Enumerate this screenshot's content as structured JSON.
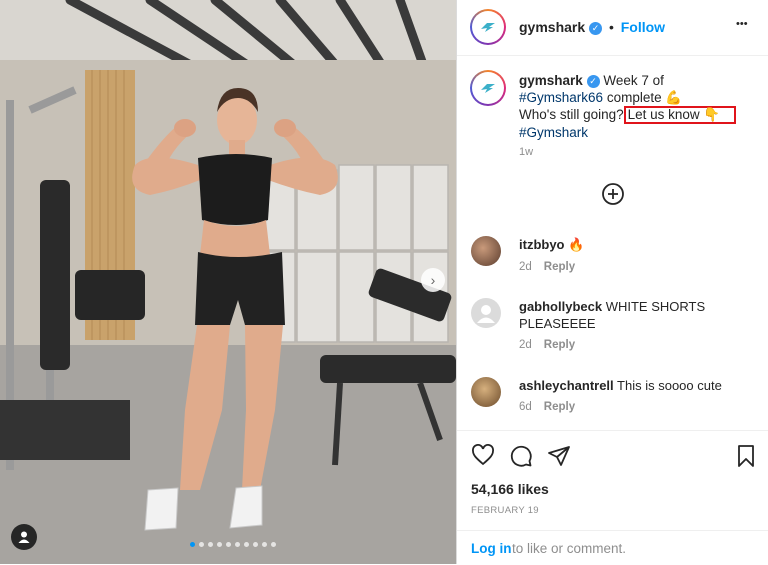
{
  "post": {
    "account": "gymshark",
    "follow_label": "Follow",
    "header_separator": "•",
    "more_label": "•••"
  },
  "caption": {
    "username": "gymshark",
    "text_part1": "Week 7 of",
    "hashtag1": "#Gymshark66",
    "text_part2": "complete 💪",
    "text_part3": "Who's still going?",
    "highlight": "Let us know 👇",
    "hashtag2": "#Gymshark",
    "time": "1w"
  },
  "comments": [
    {
      "username": "itzbbyo",
      "text": "🔥",
      "time": "2d",
      "reply": "Reply"
    },
    {
      "username": "gabhollybeck",
      "text": "WHITE SHORTS PLEASEEEE",
      "time": "2d",
      "reply": "Reply"
    },
    {
      "username": "ashleychantrell",
      "text": "This is soooo cute",
      "time": "6d",
      "reply": "Reply"
    }
  ],
  "stats": {
    "likes": "54,166 likes",
    "date": "FEBRUARY 19"
  },
  "footer": {
    "login_label": "Log in",
    "login_rest": "to like or comment."
  },
  "carousel": {
    "total_slides": 10,
    "active_slide": 1
  },
  "colors": {
    "accent": "#0095f6",
    "highlight_box": "#e0141b",
    "verified": "#3897f0"
  }
}
